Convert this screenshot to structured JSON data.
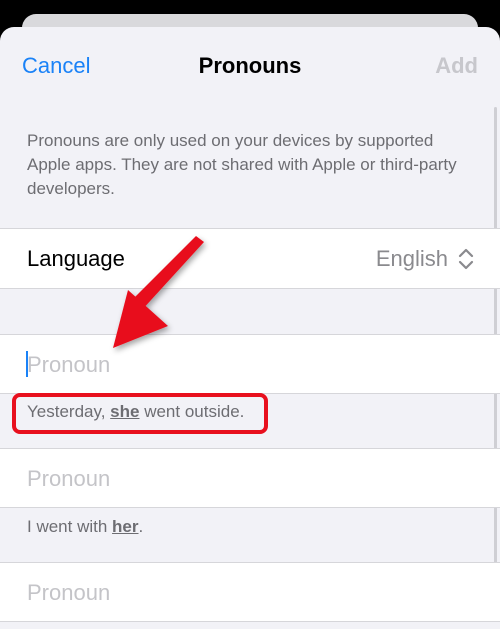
{
  "nav": {
    "cancel_label": "Cancel",
    "title": "Pronouns",
    "add_label": "Add"
  },
  "info_text": "Pronouns are only used on your devices by supported Apple apps. They are not shared with Apple or third-party developers.",
  "language": {
    "label": "Language",
    "value": "English",
    "icon": "chevron-up-down-icon"
  },
  "pronoun_fields": [
    {
      "placeholder": "Pronoun",
      "value": "",
      "focused": true
    },
    {
      "placeholder": "Pronoun",
      "value": ""
    },
    {
      "placeholder": "Pronoun",
      "value": ""
    }
  ],
  "examples": [
    {
      "before": "Yesterday, ",
      "pronoun": "she",
      "after": " went outside."
    },
    {
      "before": "I went with ",
      "pronoun": "her",
      "after": "."
    }
  ],
  "annotation": {
    "arrow_color": "#e8101e",
    "highlight_color": "#e8101e"
  },
  "colors": {
    "accent": "#1a82f7",
    "disabled": "#c7c7cc",
    "secondary_text": "#6d6d72",
    "background": "#f2f2f7"
  }
}
